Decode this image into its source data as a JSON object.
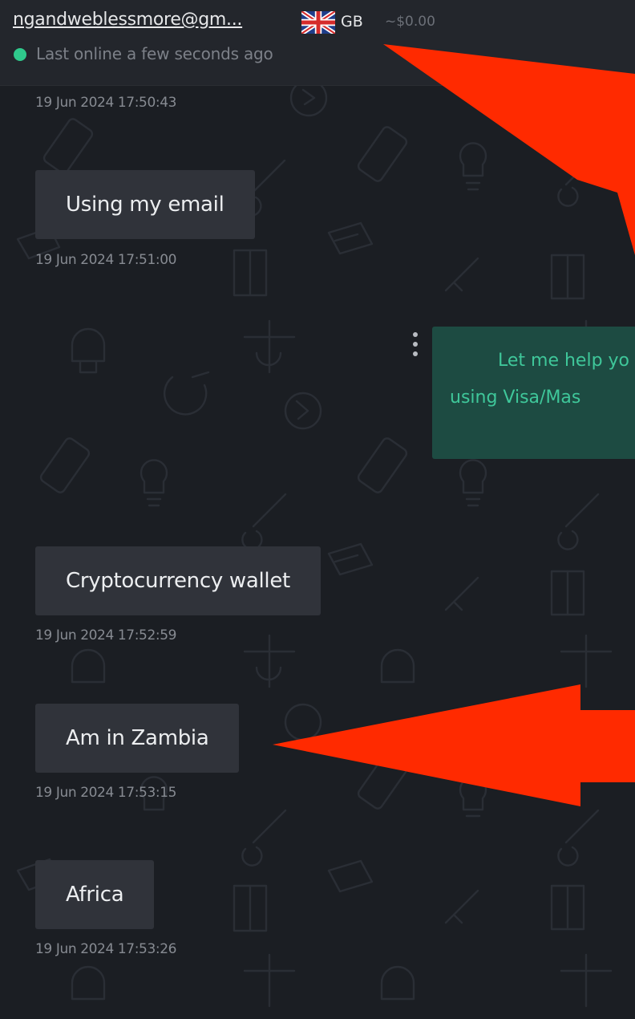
{
  "header": {
    "email": "ngandweblessmore@gm...",
    "country_code": "GB",
    "balance": "~$0.00",
    "status": "Last online a few seconds ago"
  },
  "messages": [
    {
      "timestamp": "19 Jun 2024 17:50:43"
    },
    {
      "text": "Using my email",
      "timestamp": "19 Jun 2024 17:51:00"
    },
    {
      "outgoing_line_1": "Let me help yo",
      "outgoing_line_2": "using Visa/Mas"
    },
    {
      "text": "Cryptocurrency wallet",
      "timestamp": "19 Jun 2024 17:52:59"
    },
    {
      "text": "Am in Zambia",
      "timestamp": "19 Jun 2024 17:53:15"
    },
    {
      "text": "Africa",
      "timestamp": "19 Jun 2024 17:53:26"
    }
  ],
  "icons": {
    "flag": "uk-flag-icon",
    "status": "online-dot-icon",
    "message_menu": "more-vertical-icon",
    "annotations": "red-arrow-annotation"
  },
  "colors": {
    "background": "#1b1e23",
    "header": "#23262c",
    "incoming_bubble": "#30333a",
    "outgoing_bubble": "#1d4b42",
    "outgoing_text": "#3fc79a",
    "online": "#2fc98c",
    "annotation": "#ff2a00"
  }
}
